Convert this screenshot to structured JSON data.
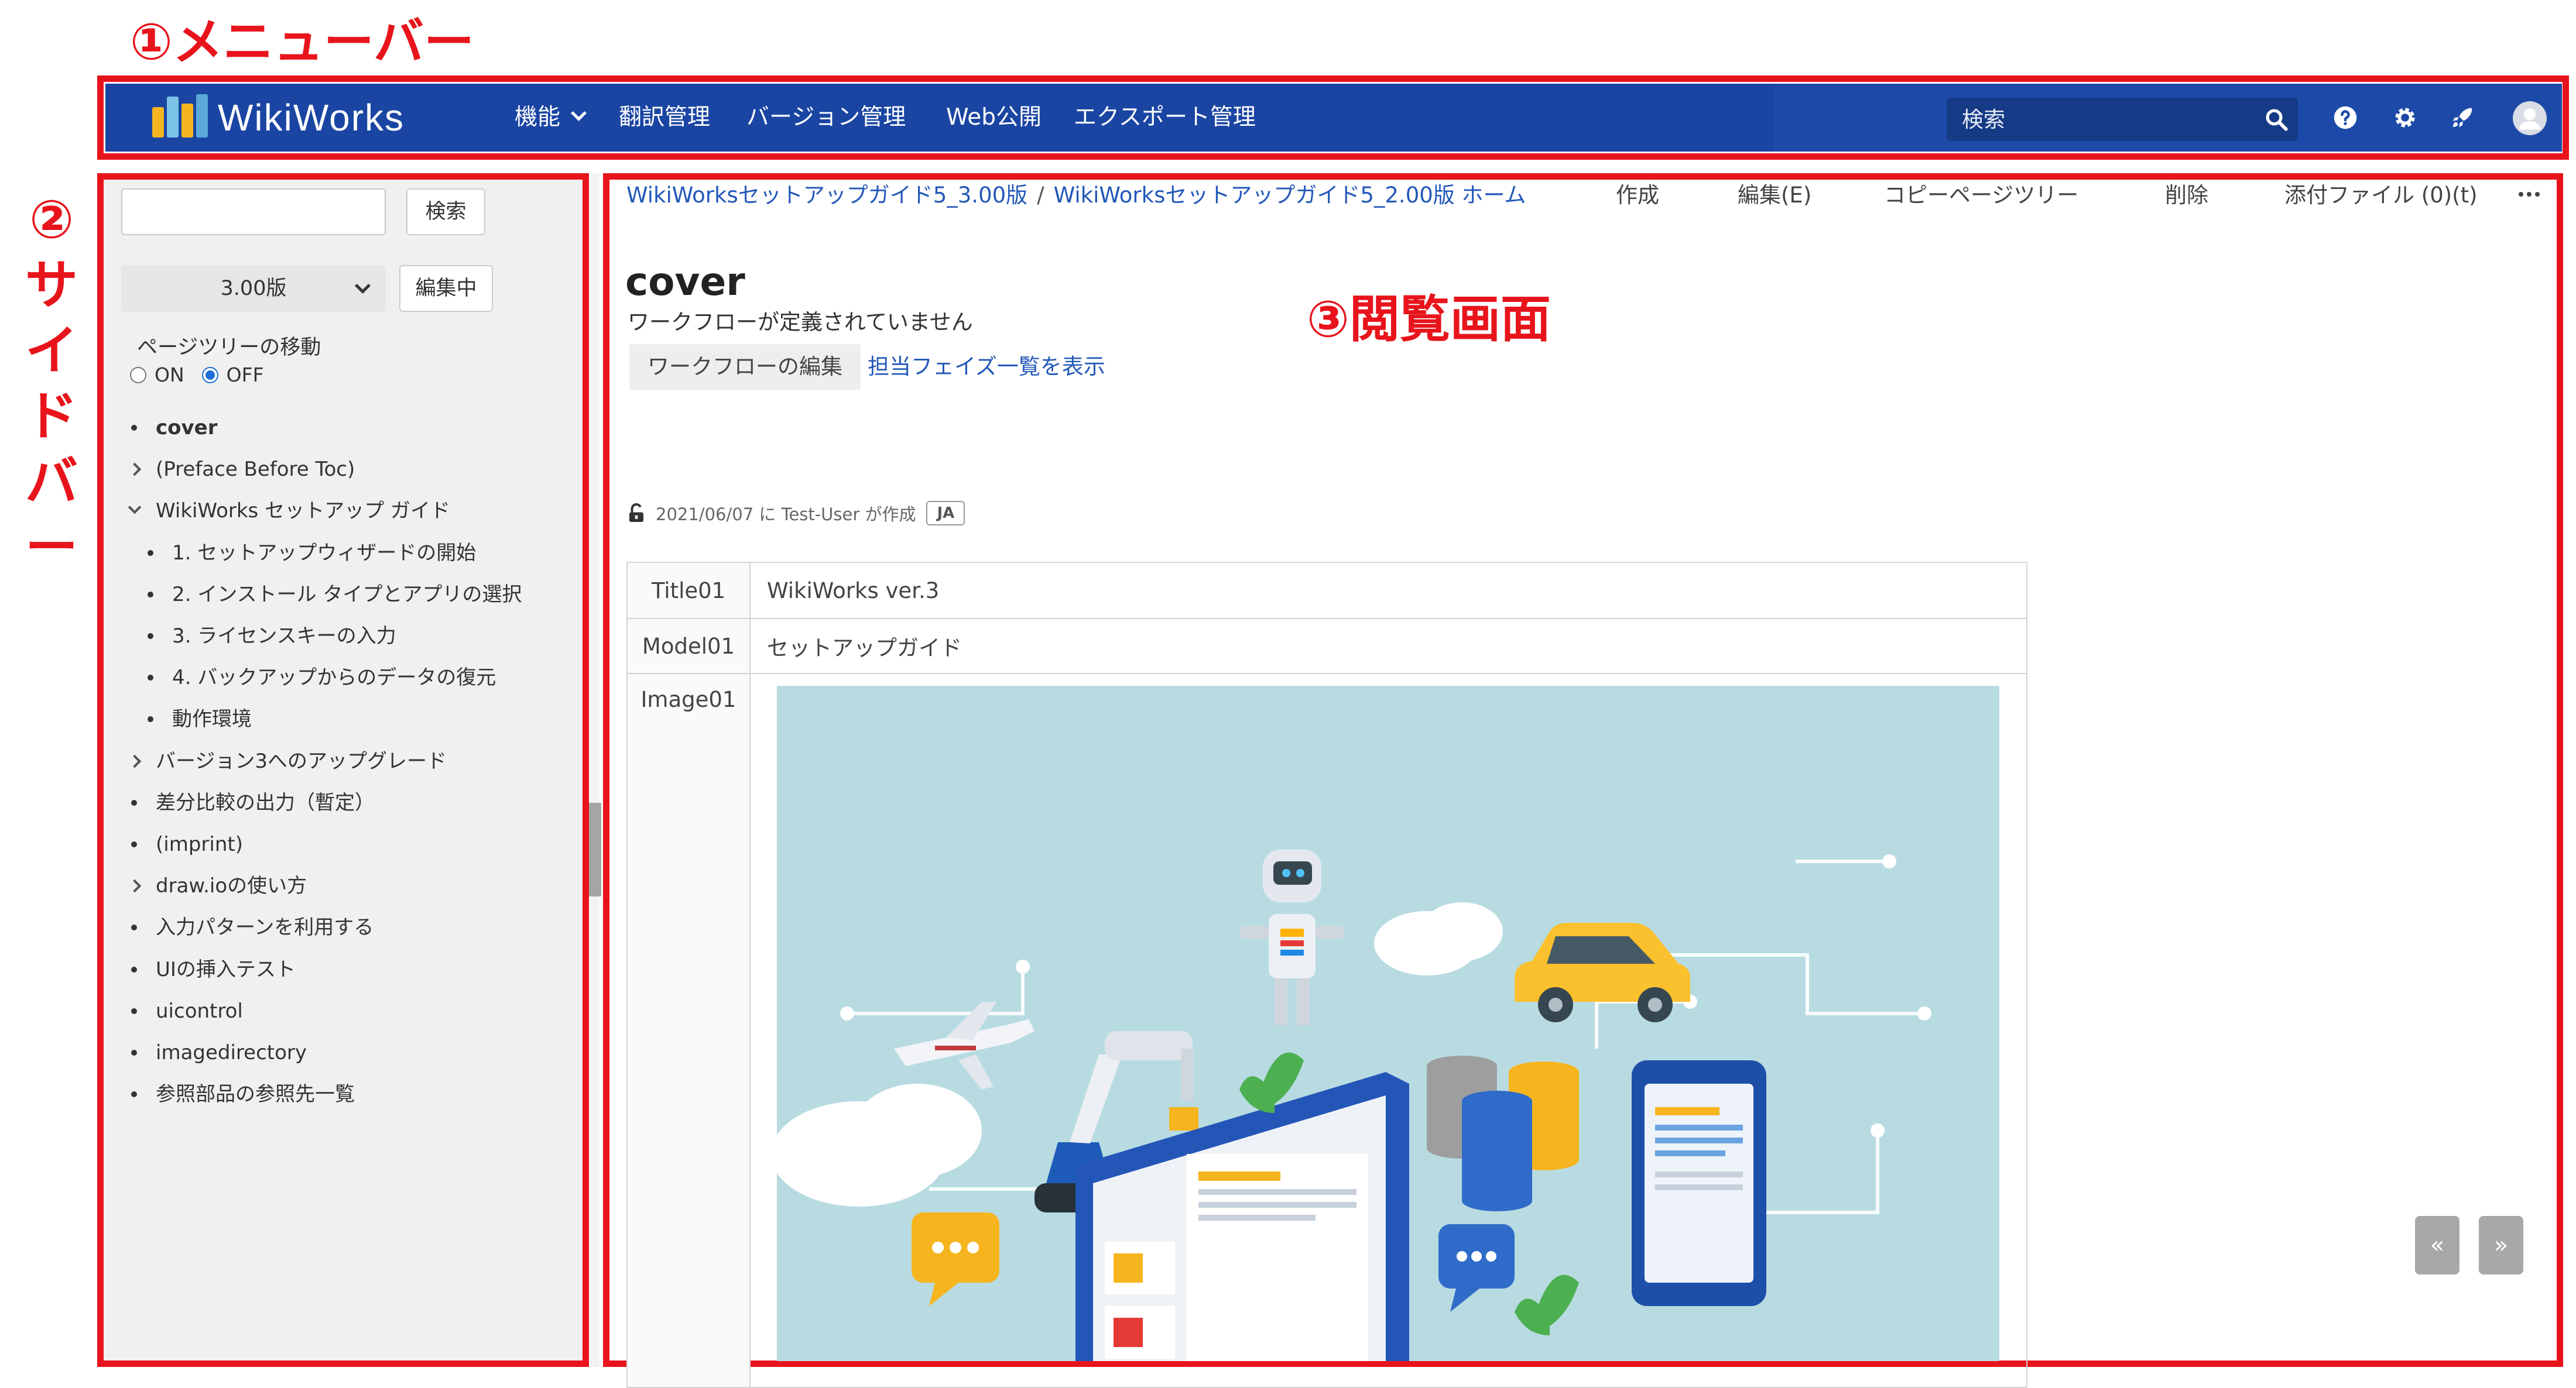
{
  "annotations": {
    "menubar": "①メニューバー",
    "sidebar": [
      "②",
      "サ",
      "イ",
      "ド",
      "バ",
      "ー"
    ],
    "viewer": "③閲覧画面"
  },
  "colors": {
    "annotation": "#e8141c",
    "navbar": "#1d4aa8",
    "link": "#2258b8"
  },
  "navbar": {
    "logo_text": "WikiWorks",
    "items": [
      "機能",
      "翻訳管理",
      "バージョン管理",
      "Web公開",
      "エクスポート管理"
    ],
    "search_placeholder": "検索",
    "icons": [
      "search-icon",
      "help-icon",
      "gear-icon",
      "rocket-icon",
      "user-avatar-icon"
    ]
  },
  "sidebar": {
    "search_button": "検索",
    "version": "3.00版",
    "editing_button": "編集中",
    "move_label": "ページツリーの移動",
    "radio_on": "ON",
    "radio_off": "OFF",
    "tree": [
      {
        "label": "cover",
        "marker": "bullet",
        "level": 0,
        "active": true
      },
      {
        "label": "(Preface Before Toc)",
        "marker": "arrow",
        "level": 0
      },
      {
        "label": "WikiWorks セットアップ ガイド",
        "marker": "arrow-open",
        "level": 0
      },
      {
        "label": "1. セットアップウィザードの開始",
        "marker": "bullet",
        "level": 1
      },
      {
        "label": "2. インストール タイプとアプリの選択",
        "marker": "bullet",
        "level": 1
      },
      {
        "label": "3. ライセンスキーの入力",
        "marker": "bullet",
        "level": 1
      },
      {
        "label": "4. バックアップからのデータの復元",
        "marker": "bullet",
        "level": 1
      },
      {
        "label": "動作環境",
        "marker": "bullet",
        "level": 1
      },
      {
        "label": "バージョン3へのアップグレード",
        "marker": "arrow",
        "level": 0
      },
      {
        "label": "差分比較の出力（暫定）",
        "marker": "bullet",
        "level": 0
      },
      {
        "label": "(imprint)",
        "marker": "bullet",
        "level": 0
      },
      {
        "label": "draw.ioの使い方",
        "marker": "arrow",
        "level": 0
      },
      {
        "label": "入力パターンを利用する",
        "marker": "bullet",
        "level": 0
      },
      {
        "label": "UIの挿入テスト",
        "marker": "bullet",
        "level": 0
      },
      {
        "label": "uicontrol",
        "marker": "bullet",
        "level": 0
      },
      {
        "label": "imagedirectory",
        "marker": "bullet",
        "level": 0
      },
      {
        "label": "参照部品の参照先一覧",
        "marker": "bullet",
        "level": 0
      }
    ]
  },
  "viewer": {
    "breadcrumb": [
      "WikiWorksセットアップガイド5_3.00版",
      "WikiWorksセットアップガイド5_2.00版 ホーム"
    ],
    "breadcrumb_sep": "/",
    "toolbar": [
      "作成",
      "編集(E)",
      "コピーページツリー",
      "削除",
      "添付ファイル (0)(t)"
    ],
    "title": "cover",
    "workflow_status": "ワークフローが定義されていません",
    "workflow_edit": "ワークフローの編集",
    "phase_link": "担当フェイズ一覧を表示",
    "created": "2021/06/07 に Test-User が作成",
    "lang": "JA",
    "table": [
      {
        "label": "Title01",
        "value": "WikiWorks ver.3"
      },
      {
        "label": "Model01",
        "value": "セットアップガイド"
      },
      {
        "label": "Image01",
        "value": ""
      }
    ],
    "pager_prev": "«",
    "pager_next": "»"
  }
}
